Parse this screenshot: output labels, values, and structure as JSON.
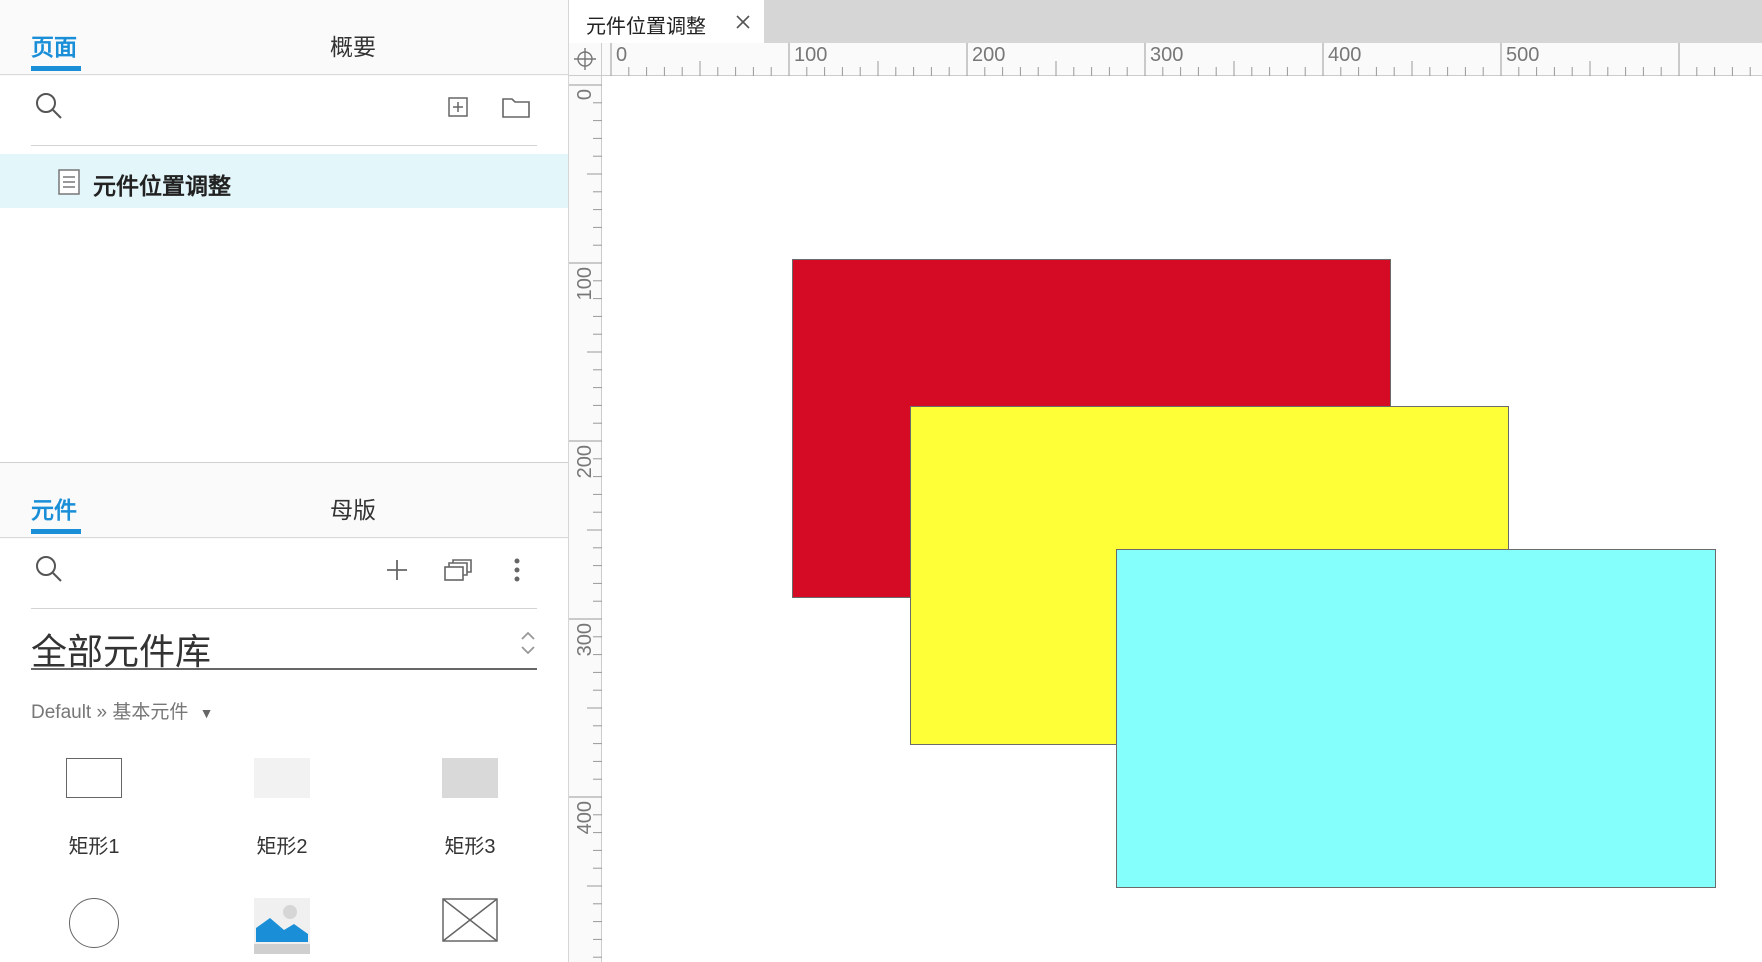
{
  "pages_panel": {
    "tabs": [
      {
        "label": "页面",
        "active": true
      },
      {
        "label": "概要",
        "active": false
      }
    ],
    "search_icon": "search-icon",
    "add_page_icon": "add-page-icon",
    "add_folder_icon": "folder-icon",
    "pages": [
      {
        "label": "元件位置调整",
        "icon": "document-icon",
        "selected": true
      }
    ]
  },
  "widgets_panel": {
    "tabs": [
      {
        "label": "元件",
        "active": true
      },
      {
        "label": "母版",
        "active": false
      }
    ],
    "library_select": "全部元件库",
    "breadcrumb": "Default » 基本元件",
    "widgets": [
      {
        "label": "矩形1",
        "icon": "rectangle-outline-icon"
      },
      {
        "label": "矩形2",
        "icon": "rectangle-light-icon"
      },
      {
        "label": "矩形3",
        "icon": "rectangle-gray-icon"
      },
      {
        "label": "",
        "icon": "circle-icon"
      },
      {
        "label": "",
        "icon": "image-icon"
      },
      {
        "label": "",
        "icon": "placeholder-icon"
      }
    ]
  },
  "document_tabs": [
    {
      "label": "元件位置调整",
      "active": true
    }
  ],
  "rulers": {
    "horizontal_labels": [
      "0",
      "100",
      "200",
      "300",
      "400",
      "500"
    ],
    "vertical_labels": [
      "0",
      "100",
      "200",
      "300",
      "400"
    ]
  },
  "canvas": {
    "shapes": [
      {
        "name": "red-rectangle",
        "fill": "#d50b26"
      },
      {
        "name": "yellow-rectangle",
        "fill": "#ffff38"
      },
      {
        "name": "cyan-rectangle",
        "fill": "#84fffb"
      }
    ]
  },
  "colors": {
    "accent": "#1a8fd8",
    "selected_row": "#e3f6fa"
  }
}
